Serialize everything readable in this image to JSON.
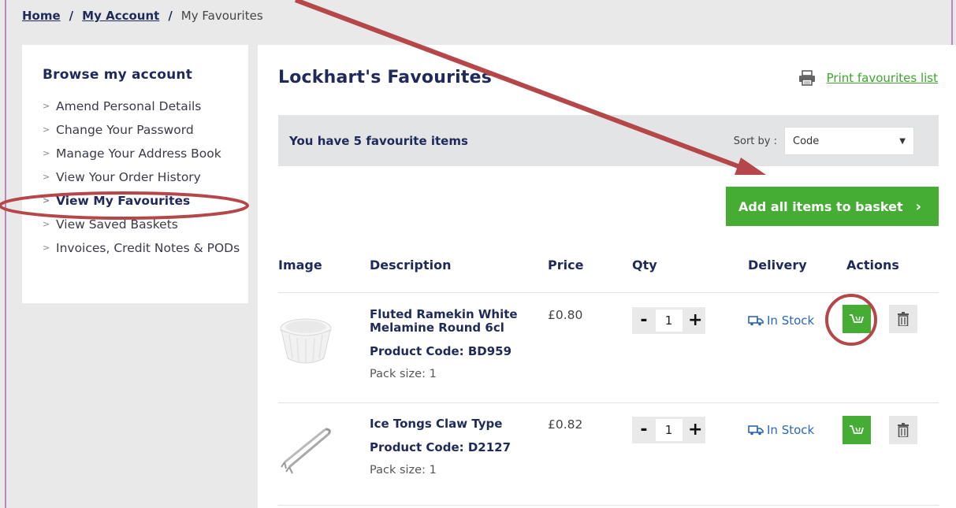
{
  "breadcrumb": {
    "home": "Home",
    "sep1": "/",
    "account": "My Account",
    "sep2": "/",
    "current": "My Favourites"
  },
  "sidebar": {
    "title": "Browse my account",
    "items": [
      {
        "label": "Amend Personal Details"
      },
      {
        "label": "Change Your Password"
      },
      {
        "label": "Manage Your Address Book"
      },
      {
        "label": "View Your Order History"
      },
      {
        "label": "View My Favourites"
      },
      {
        "label": "View Saved Baskets"
      },
      {
        "label": "Invoices, Credit Notes & PODs"
      }
    ]
  },
  "main": {
    "title": "Lockhart's Favourites",
    "print_label": "Print favourites list",
    "summary": "You have 5 favourite items",
    "sort_label": "Sort by :",
    "sort_value": "Code",
    "add_all_label": "Add all items to basket",
    "add_all_arrow": "›",
    "columns": [
      "Image",
      "Description",
      "Price",
      "Qty",
      "Delivery",
      "Actions"
    ],
    "products": [
      {
        "name": "Fluted Ramekin White Melamine Round 6cl",
        "code": "Product Code:  BD959",
        "pack": "Pack size:  1",
        "price": "£0.80",
        "qty": "1",
        "stock": "In Stock"
      },
      {
        "name": "Ice Tongs Claw Type",
        "code": "Product Code:  D2127",
        "pack": "Pack size:  1",
        "price": "£0.82",
        "qty": "1",
        "stock": "In Stock"
      }
    ],
    "qty_minus": "-",
    "qty_plus": "+"
  },
  "colors": {
    "brand_navy": "#1f2a5a",
    "action_green": "#46ad34",
    "stock_blue": "#2c66b8",
    "annotation_red": "#b5474a"
  },
  "icons": [
    "printer-icon",
    "truck-icon",
    "cart-icon",
    "trash-icon",
    "chevron-right-icon"
  ]
}
